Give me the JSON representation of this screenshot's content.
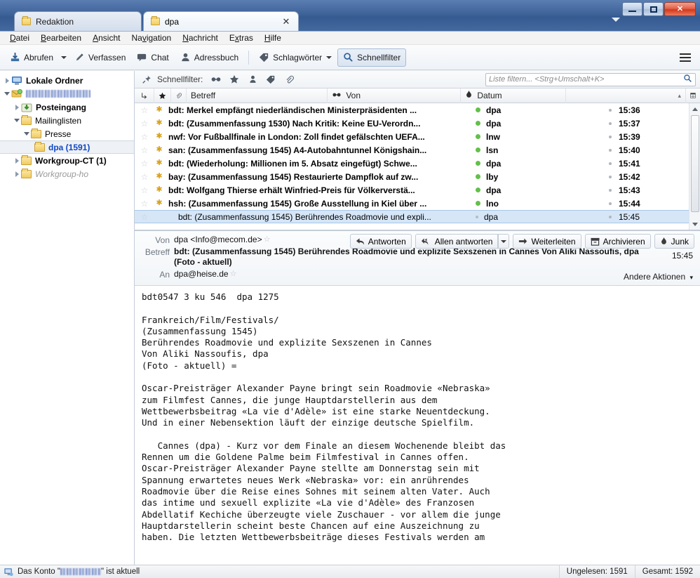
{
  "window": {
    "minimize_label": "–",
    "maximize_label": "□",
    "close_label": "✕"
  },
  "tabs": [
    {
      "label": "Redaktion",
      "icon": "folder-icon",
      "active": false,
      "closable": false
    },
    {
      "label": "dpa",
      "icon": "folder-icon",
      "active": true,
      "closable": true,
      "close_label": "✕"
    }
  ],
  "menubar": {
    "items": [
      {
        "label": "Datei",
        "accel": "D"
      },
      {
        "label": "Bearbeiten",
        "accel": "B"
      },
      {
        "label": "Ansicht",
        "accel": "A"
      },
      {
        "label": "Navigation",
        "accel": "v"
      },
      {
        "label": "Nachricht",
        "accel": "N"
      },
      {
        "label": "Extras",
        "accel": "x"
      },
      {
        "label": "Hilfe",
        "accel": "H"
      }
    ]
  },
  "toolbar": {
    "abrufen_label": "Abrufen",
    "verfassen_label": "Verfassen",
    "chat_label": "Chat",
    "adressbuch_label": "Adressbuch",
    "schlagwoerter_label": "Schlagwörter",
    "schnellfilter_label": "Schnellfilter",
    "appmenu_name": "hamburger-menu-icon"
  },
  "folderpane": {
    "items": [
      {
        "label": "Lokale Ordner",
        "style": "bold",
        "indent": 0,
        "twisty": "collapsed",
        "icon": "computer-icon"
      },
      {
        "label": "",
        "style": "blurred",
        "indent": 0,
        "twisty": "expanded",
        "icon": "account-icon"
      },
      {
        "label": "Posteingang",
        "style": "bold",
        "indent": 1,
        "twisty": "collapsed",
        "icon": "inbox-icon"
      },
      {
        "label": "Mailinglisten",
        "style": "normal",
        "indent": 1,
        "twisty": "expanded",
        "icon": "folder-icon"
      },
      {
        "label": "Presse",
        "style": "normal",
        "indent": 2,
        "twisty": "expanded",
        "icon": "folder-icon"
      },
      {
        "label": "dpa (1591)",
        "style": "selected",
        "indent": 3,
        "twisty": "none",
        "icon": "folder-icon"
      },
      {
        "label": "Workgroup-CT (1)",
        "style": "bold",
        "indent": 1,
        "twisty": "collapsed",
        "icon": "folder-icon"
      },
      {
        "label": "Workgroup-ho",
        "style": "italic",
        "indent": 1,
        "twisty": "collapsed",
        "icon": "folder-icon"
      }
    ]
  },
  "quickfilter": {
    "label": "Schnellfilter:",
    "pin_icon": "pin-icon",
    "icons": [
      {
        "name": "unread-glasses-icon",
        "glyph": "⚭"
      },
      {
        "name": "starred-icon",
        "glyph": "★"
      },
      {
        "name": "contact-icon",
        "glyph": "♟"
      },
      {
        "name": "tag-icon",
        "glyph": "⬥"
      },
      {
        "name": "attachment-icon",
        "glyph": "📎"
      }
    ],
    "search_placeholder": "Liste filtern... <Strg+Umschalt+K>",
    "search_value": "",
    "search_icon": "search-icon"
  },
  "messagelist": {
    "columns": {
      "thread_icon": "thread-icon",
      "star_icon": "star-icon",
      "attachment_icon": "attachment-icon",
      "subject": "Betreff",
      "from_icon": "unread-glasses-icon",
      "from": "Von",
      "date_icon": "flame-icon",
      "date": "Datum",
      "sort_indicator": "▴",
      "column_picker_icon": "column-picker-icon"
    },
    "rows": [
      {
        "subject": "bdt: Merkel empfängt niederländischen Ministerpräsidenten ...",
        "from": "dpa",
        "date": "15:36",
        "unread": true,
        "selected": false
      },
      {
        "subject": "bdt: (Zusammenfassung 1530) Nach Kritik: Keine EU-Verordn...",
        "from": "dpa",
        "date": "15:37",
        "unread": true,
        "selected": false
      },
      {
        "subject": "nwf: Vor Fußballfinale in London: Zoll findet gefälschten UEFA...",
        "from": "lnw",
        "date": "15:39",
        "unread": true,
        "selected": false
      },
      {
        "subject": "san: (Zusammenfassung 1545) A4-Autobahntunnel Königshain...",
        "from": "lsn",
        "date": "15:40",
        "unread": true,
        "selected": false
      },
      {
        "subject": "bdt: (Wiederholung: Millionen im 5. Absatz eingefügt) Schwe...",
        "from": "dpa",
        "date": "15:41",
        "unread": true,
        "selected": false
      },
      {
        "subject": "bay: (Zusammenfassung 1545) Restaurierte Dampflok auf zw...",
        "from": "lby",
        "date": "15:42",
        "unread": true,
        "selected": false
      },
      {
        "subject": "bdt: Wolfgang Thierse erhält Winfried-Preis für Völkerverstä...",
        "from": "dpa",
        "date": "15:43",
        "unread": true,
        "selected": false
      },
      {
        "subject": "hsh: (Zusammenfassung 1545) Große Ausstellung in Kiel über ...",
        "from": "lno",
        "date": "15:44",
        "unread": true,
        "selected": false
      },
      {
        "subject": "bdt: (Zusammenfassung 1545) Berührendes Roadmovie und expli...",
        "from": "dpa",
        "date": "15:45",
        "unread": false,
        "selected": true
      }
    ]
  },
  "messageheader": {
    "von_label": "Von",
    "von_value": "dpa <Info@mecom.de>",
    "betreff_label": "Betreff",
    "betreff_value": "bdt: (Zusammenfassung 1545) Berührendes Roadmovie und explizite Sexszenen in Cannes Von Aliki Nassoufis, dpa",
    "betreff_value2": "(Foto - aktuell)",
    "an_label": "An",
    "an_value": "dpa@heise.de",
    "date": "15:45",
    "andere_aktionen": "Andere Aktionen",
    "buttons": [
      {
        "label": "Antworten",
        "icon": "reply-icon"
      },
      {
        "label": "Allen antworten",
        "icon": "reply-all-icon",
        "has_dropdown": true
      },
      {
        "label": "Weiterleiten",
        "icon": "forward-arrow-icon"
      },
      {
        "label": "Archivieren",
        "icon": "archive-box-icon"
      },
      {
        "label": "Junk",
        "icon": "flame-icon"
      }
    ]
  },
  "messagebody": {
    "text": "bdt0547 3 ku 546  dpa 1275\n\nFrankreich/Film/Festivals/\n(Zusammenfassung 1545)\nBerührendes Roadmovie und explizite Sexszenen in Cannes\nVon Aliki Nassoufis, dpa\n(Foto - aktuell) =\n\nOscar-Preisträger Alexander Payne bringt sein Roadmovie «Nebraska»\nzum Filmfest Cannes, die junge Hauptdarstellerin aus dem\nWettbewerbsbeitrag «La vie d'Adèle» ist eine starke Neuentdeckung.\nUnd in einer Nebensektion läuft der einzige deutsche Spielfilm.\n\n   Cannes (dpa) - Kurz vor dem Finale an diesem Wochenende bleibt das\nRennen um die Goldene Palme beim Filmfestival in Cannes offen.\nOscar-Preisträger Alexander Payne stellte am Donnerstag sein mit\nSpannung erwartetes neues Werk «Nebraska» vor: ein anrührendes\nRoadmovie über die Reise eines Sohnes mit seinem alten Vater. Auch\ndas intime und sexuell explizite «La vie d'Adèle» des Franzosen\nAbdellatif Kechiche überzeugte viele Zuschauer - vor allem die junge\nHauptdarstellerin scheint beste Chancen auf eine Auszeichnung zu\nhaben. Die letzten Wettbewerbsbeiträge dieses Festivals werden am"
  },
  "statusbar": {
    "prefix": "Das Konto \"",
    "suffix": "\" ist aktuell",
    "ungelesen": "Ungelesen: 1591",
    "gesamt": "Gesamt: 1592",
    "status_icon": "account-status-icon"
  }
}
